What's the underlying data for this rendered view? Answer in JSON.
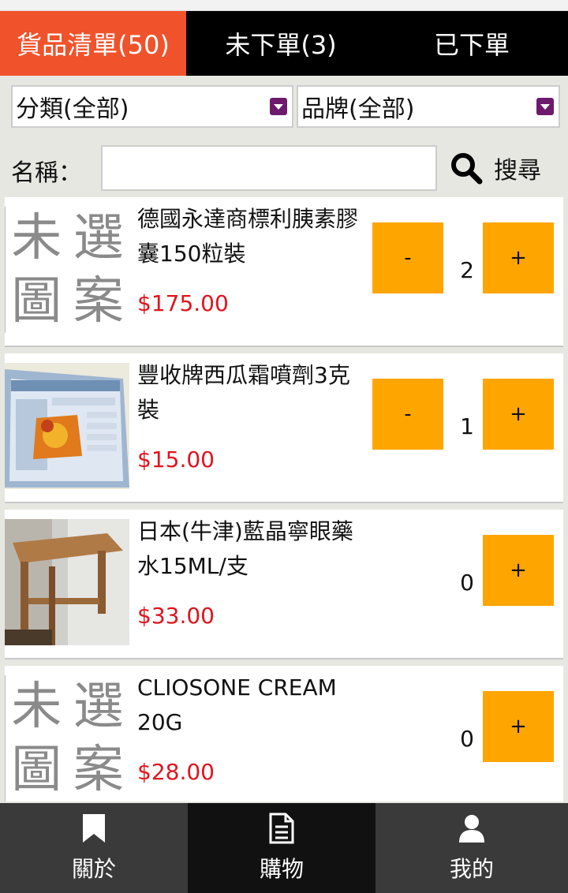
{
  "tabs": [
    {
      "label": "貨品清單(50)"
    },
    {
      "label": "未下單(3)"
    },
    {
      "label": "已下單"
    }
  ],
  "filters": {
    "category": "分類(全部)",
    "brand": "品牌(全部)",
    "name_label": "名稱：",
    "name_value": "",
    "search_label": "搜尋"
  },
  "products": [
    {
      "title": "德國永達商標利胰素膠囊150粒裝",
      "price": "$175.00",
      "qty": "2",
      "minus": "-",
      "plus": "+",
      "image": "placeholder"
    },
    {
      "title": "豐收牌西瓜霜噴劑3克裝",
      "price": "$15.00",
      "qty": "1",
      "minus": "-",
      "plus": "+",
      "image": "photo-screen"
    },
    {
      "title": "日本(牛津)藍晶寧眼藥水15ML/支",
      "price": "$33.00",
      "qty": "0",
      "plus": "+",
      "image": "photo-stool"
    },
    {
      "title": "CLIOSONE CREAM 20G",
      "price": "$28.00",
      "qty": "0",
      "plus": "+",
      "image": "placeholder"
    }
  ],
  "placeholder_chars": [
    "未",
    "選",
    "圖",
    "案"
  ],
  "nav": [
    {
      "label": "關於",
      "icon": "bookmark-icon"
    },
    {
      "label": "購物",
      "icon": "document-icon"
    },
    {
      "label": "我的",
      "icon": "user-icon"
    }
  ],
  "colors": {
    "active_tab": "#f0522b",
    "button": "#ffa500",
    "price": "#e0141e",
    "select_arrow": "#6d1a6d"
  }
}
